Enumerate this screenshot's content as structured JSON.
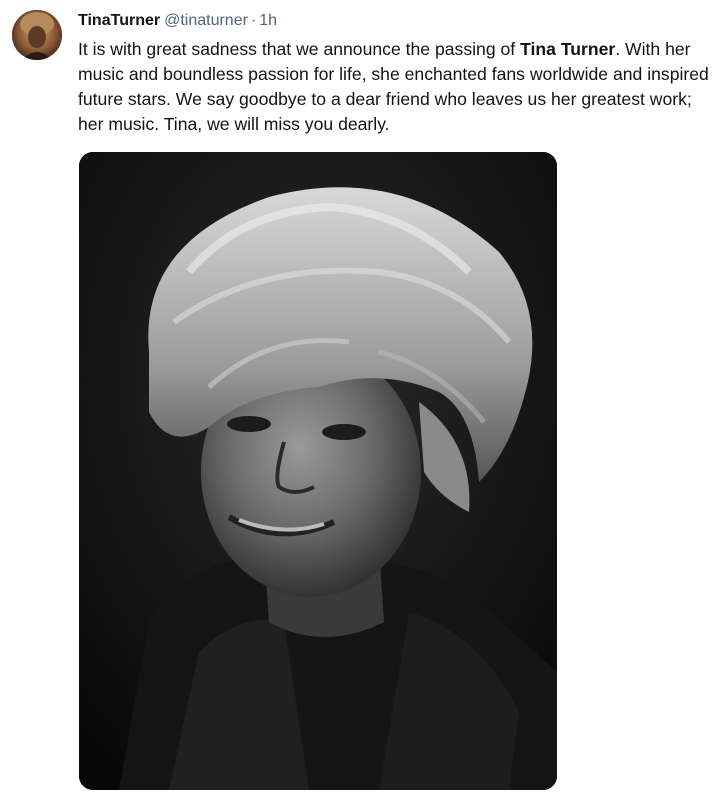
{
  "tweet": {
    "author": {
      "display_name": "TinaTurner",
      "handle": "@tinaturner",
      "separator": "·",
      "time": "1h",
      "avatar_icon": "avatar-photo"
    },
    "text": {
      "before_bold": "It is with great sadness that we announce the passing of ",
      "bold": "Tina Turner",
      "after_bold": ". With her music and boundless passion for life, she enchanted fans worldwide and inspired future stars. We say goodbye to a dear friend who leaves us her greatest work; her music. Tina, we will miss you dearly."
    },
    "media": {
      "kind": "photo",
      "style": "black-and-white portrait"
    }
  },
  "colors": {
    "text_primary": "#0f1419",
    "text_secondary": "#536471",
    "background": "#ffffff"
  }
}
